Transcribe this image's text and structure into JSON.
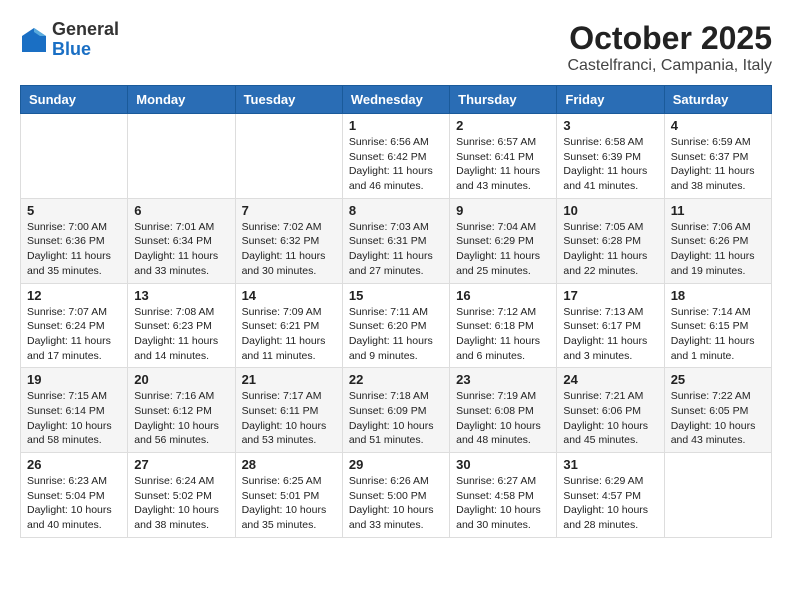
{
  "header": {
    "logo_general": "General",
    "logo_blue": "Blue",
    "month_title": "October 2025",
    "location": "Castelfranci, Campania, Italy"
  },
  "days_of_week": [
    "Sunday",
    "Monday",
    "Tuesday",
    "Wednesday",
    "Thursday",
    "Friday",
    "Saturday"
  ],
  "weeks": [
    [
      {
        "day": "",
        "info": ""
      },
      {
        "day": "",
        "info": ""
      },
      {
        "day": "",
        "info": ""
      },
      {
        "day": "1",
        "info": "Sunrise: 6:56 AM\nSunset: 6:42 PM\nDaylight: 11 hours and 46 minutes."
      },
      {
        "day": "2",
        "info": "Sunrise: 6:57 AM\nSunset: 6:41 PM\nDaylight: 11 hours and 43 minutes."
      },
      {
        "day": "3",
        "info": "Sunrise: 6:58 AM\nSunset: 6:39 PM\nDaylight: 11 hours and 41 minutes."
      },
      {
        "day": "4",
        "info": "Sunrise: 6:59 AM\nSunset: 6:37 PM\nDaylight: 11 hours and 38 minutes."
      }
    ],
    [
      {
        "day": "5",
        "info": "Sunrise: 7:00 AM\nSunset: 6:36 PM\nDaylight: 11 hours and 35 minutes."
      },
      {
        "day": "6",
        "info": "Sunrise: 7:01 AM\nSunset: 6:34 PM\nDaylight: 11 hours and 33 minutes."
      },
      {
        "day": "7",
        "info": "Sunrise: 7:02 AM\nSunset: 6:32 PM\nDaylight: 11 hours and 30 minutes."
      },
      {
        "day": "8",
        "info": "Sunrise: 7:03 AM\nSunset: 6:31 PM\nDaylight: 11 hours and 27 minutes."
      },
      {
        "day": "9",
        "info": "Sunrise: 7:04 AM\nSunset: 6:29 PM\nDaylight: 11 hours and 25 minutes."
      },
      {
        "day": "10",
        "info": "Sunrise: 7:05 AM\nSunset: 6:28 PM\nDaylight: 11 hours and 22 minutes."
      },
      {
        "day": "11",
        "info": "Sunrise: 7:06 AM\nSunset: 6:26 PM\nDaylight: 11 hours and 19 minutes."
      }
    ],
    [
      {
        "day": "12",
        "info": "Sunrise: 7:07 AM\nSunset: 6:24 PM\nDaylight: 11 hours and 17 minutes."
      },
      {
        "day": "13",
        "info": "Sunrise: 7:08 AM\nSunset: 6:23 PM\nDaylight: 11 hours and 14 minutes."
      },
      {
        "day": "14",
        "info": "Sunrise: 7:09 AM\nSunset: 6:21 PM\nDaylight: 11 hours and 11 minutes."
      },
      {
        "day": "15",
        "info": "Sunrise: 7:11 AM\nSunset: 6:20 PM\nDaylight: 11 hours and 9 minutes."
      },
      {
        "day": "16",
        "info": "Sunrise: 7:12 AM\nSunset: 6:18 PM\nDaylight: 11 hours and 6 minutes."
      },
      {
        "day": "17",
        "info": "Sunrise: 7:13 AM\nSunset: 6:17 PM\nDaylight: 11 hours and 3 minutes."
      },
      {
        "day": "18",
        "info": "Sunrise: 7:14 AM\nSunset: 6:15 PM\nDaylight: 11 hours and 1 minute."
      }
    ],
    [
      {
        "day": "19",
        "info": "Sunrise: 7:15 AM\nSunset: 6:14 PM\nDaylight: 10 hours and 58 minutes."
      },
      {
        "day": "20",
        "info": "Sunrise: 7:16 AM\nSunset: 6:12 PM\nDaylight: 10 hours and 56 minutes."
      },
      {
        "day": "21",
        "info": "Sunrise: 7:17 AM\nSunset: 6:11 PM\nDaylight: 10 hours and 53 minutes."
      },
      {
        "day": "22",
        "info": "Sunrise: 7:18 AM\nSunset: 6:09 PM\nDaylight: 10 hours and 51 minutes."
      },
      {
        "day": "23",
        "info": "Sunrise: 7:19 AM\nSunset: 6:08 PM\nDaylight: 10 hours and 48 minutes."
      },
      {
        "day": "24",
        "info": "Sunrise: 7:21 AM\nSunset: 6:06 PM\nDaylight: 10 hours and 45 minutes."
      },
      {
        "day": "25",
        "info": "Sunrise: 7:22 AM\nSunset: 6:05 PM\nDaylight: 10 hours and 43 minutes."
      }
    ],
    [
      {
        "day": "26",
        "info": "Sunrise: 6:23 AM\nSunset: 5:04 PM\nDaylight: 10 hours and 40 minutes."
      },
      {
        "day": "27",
        "info": "Sunrise: 6:24 AM\nSunset: 5:02 PM\nDaylight: 10 hours and 38 minutes."
      },
      {
        "day": "28",
        "info": "Sunrise: 6:25 AM\nSunset: 5:01 PM\nDaylight: 10 hours and 35 minutes."
      },
      {
        "day": "29",
        "info": "Sunrise: 6:26 AM\nSunset: 5:00 PM\nDaylight: 10 hours and 33 minutes."
      },
      {
        "day": "30",
        "info": "Sunrise: 6:27 AM\nSunset: 4:58 PM\nDaylight: 10 hours and 30 minutes."
      },
      {
        "day": "31",
        "info": "Sunrise: 6:29 AM\nSunset: 4:57 PM\nDaylight: 10 hours and 28 minutes."
      },
      {
        "day": "",
        "info": ""
      }
    ]
  ]
}
